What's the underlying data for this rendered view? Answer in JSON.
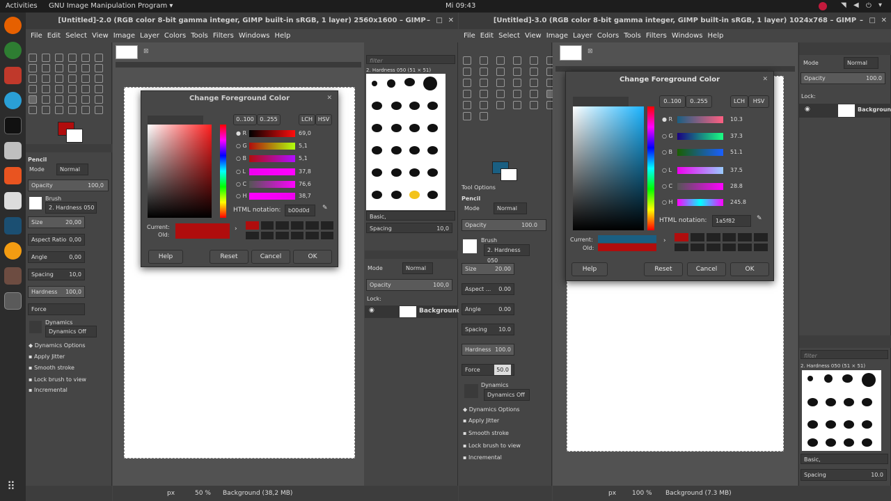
{
  "topbar": {
    "activities": "Activities",
    "app": "GNU Image Manipulation Program ▾",
    "clock": "Mi 09:43"
  },
  "window1": {
    "title": "[Untitled]-2.0 (RGB color 8-bit gamma integer, GIMP built-in sRGB, 1 layer) 2560x1600 – GIMP",
    "menu": [
      "File",
      "Edit",
      "Select",
      "View",
      "Image",
      "Layer",
      "Colors",
      "Tools",
      "Filters",
      "Windows",
      "Help"
    ],
    "status": {
      "unit": "px",
      "zoom": "50 %",
      "info": "Background (38,2 MB)"
    }
  },
  "window2": {
    "title": "[Untitled]-3.0 (RGB color 8-bit gamma integer, GIMP built-in sRGB, 1 layer) 1024x768 – GIMP",
    "menu": [
      "File",
      "Edit",
      "Select",
      "View",
      "Image",
      "Layer",
      "Colors",
      "Tools",
      "Filters",
      "Windows",
      "Help"
    ],
    "status": {
      "unit": "px",
      "zoom": "100 %",
      "info": "Background (7.3 MB)"
    }
  },
  "tooloptions1": {
    "tool": "Pencil",
    "mode_label": "Mode",
    "mode": "Normal",
    "opacity_label": "Opacity",
    "opacity": "100,0",
    "brush_label": "Brush",
    "brush": "2. Hardness 050",
    "size_label": "Size",
    "size": "20,00",
    "aspect_label": "Aspect Ratio",
    "aspect": "0,00",
    "angle_label": "Angle",
    "angle": "0,00",
    "spacing_label": "Spacing",
    "spacing": "10,0",
    "hardness_label": "Hardness",
    "hardness": "100,0",
    "force_label": "Force",
    "dynamics_label": "Dynamics",
    "dynamics": "Dynamics Off",
    "checks": [
      "Dynamics Options",
      "Apply Jitter",
      "Smooth stroke",
      "Lock brush to view",
      "Incremental"
    ]
  },
  "tooloptions2": {
    "header": "Tool Options",
    "tool": "Pencil",
    "mode_label": "Mode",
    "mode": "Normal",
    "opacity_label": "Opacity",
    "opacity": "100.0",
    "brush_label": "Brush",
    "brush": "2. Hardness 050",
    "size_label": "Size",
    "size": "20.00",
    "aspect_label": "Aspect ...",
    "aspect": "0.00",
    "angle_label": "Angle",
    "angle": "0.00",
    "spacing_label": "Spacing",
    "spacing": "10.0",
    "hardness_label": "Hardness",
    "hardness": "100.0",
    "force_label": "Force",
    "force": "50.0",
    "dynamics_label": "Dynamics",
    "dynamics": "Dynamics Off",
    "checks": [
      "Dynamics Options",
      "Apply Jitter",
      "Smooth stroke",
      "Lock brush to view",
      "Incremental"
    ]
  },
  "brushes1": {
    "filter": "filter",
    "name": "2. Hardness 050 (51 × 51)",
    "preset": "Basic,",
    "spacing_label": "Spacing",
    "spacing": "10,0"
  },
  "layers1": {
    "mode_label": "Mode",
    "mode": "Normal",
    "opacity_label": "Opacity",
    "opacity": "100,0",
    "lock_label": "Lock:",
    "layer": "Background"
  },
  "layers2": {
    "mode_label": "Mode",
    "mode": "Normal",
    "opacity_label": "Opacity",
    "opacity": "100.0",
    "lock_label": "Lock:",
    "layer": "Background"
  },
  "brushes2": {
    "filter": "filter",
    "name": "2. Hardness 050 (51 × 51)",
    "preset": "Basic,",
    "spacing_label": "Spacing",
    "spacing": "10.0"
  },
  "dialog1": {
    "title": "Change Foreground Color",
    "scale_a": "0..100",
    "scale_b": "0..255",
    "lch": "LCH",
    "hsv": "HSV",
    "channels": [
      {
        "label": "R",
        "value": "69,0"
      },
      {
        "label": "G",
        "value": "5,1"
      },
      {
        "label": "B",
        "value": "5,1"
      },
      {
        "label": "L",
        "value": "37,8"
      },
      {
        "label": "C",
        "value": "76,6"
      },
      {
        "label": "H",
        "value": "38,7"
      }
    ],
    "html_label": "HTML notation:",
    "html_value": "b00d0d",
    "current_label": "Current:",
    "old_label": "Old:",
    "current_color": "#b00d0d",
    "old_color": "#b00d0d",
    "buttons": {
      "help": "Help",
      "reset": "Reset",
      "cancel": "Cancel",
      "ok": "OK"
    }
  },
  "dialog2": {
    "title": "Change Foreground Color",
    "scale_a": "0..100",
    "scale_b": "0..255",
    "lch": "LCH",
    "hsv": "HSV",
    "channels": [
      {
        "label": "R",
        "value": "10.3"
      },
      {
        "label": "G",
        "value": "37.3"
      },
      {
        "label": "B",
        "value": "51.1"
      },
      {
        "label": "L",
        "value": "37.5"
      },
      {
        "label": "C",
        "value": "28.8"
      },
      {
        "label": "H",
        "value": "245.8"
      }
    ],
    "html_label": "HTML notation:",
    "html_value": "1a5f82",
    "current_label": "Current:",
    "old_label": "Old:",
    "current_color": "#1a5f82",
    "old_color": "#b00d0d",
    "buttons": {
      "help": "Help",
      "reset": "Reset",
      "cancel": "Cancel",
      "ok": "OK"
    }
  }
}
